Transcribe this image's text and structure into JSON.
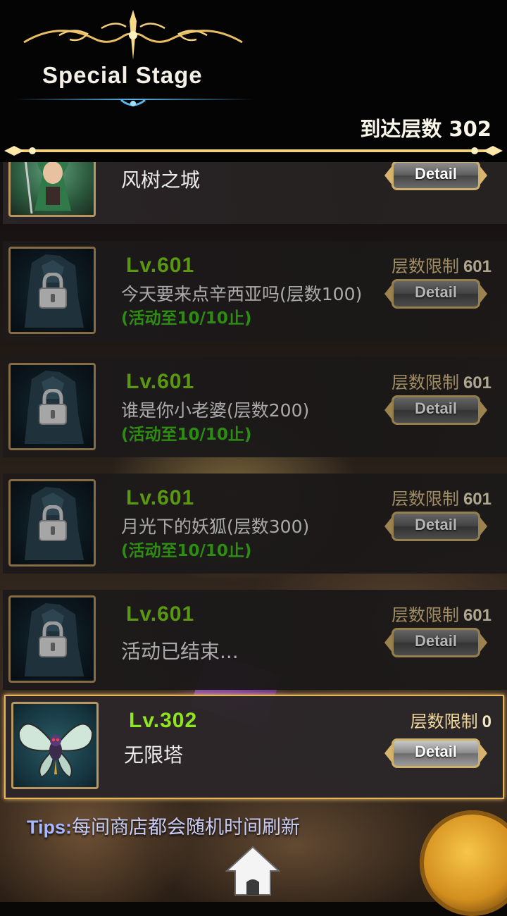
{
  "header": {
    "title": "Special Stage",
    "floor_reached_label": "到达层数",
    "floor_reached_value": "302"
  },
  "colors": {
    "level_green": "#7fd31a",
    "period_green": "#3fc21a",
    "gold_frame": "#cfb06a",
    "tips_blue": "#a8b8ff"
  },
  "stages": [
    {
      "level": "",
      "limit_label": "",
      "limit_value": "",
      "name": "风树之城",
      "period": "",
      "detail_label": "Detail",
      "locked": false,
      "portrait": "green-haired-warrior-portrait"
    },
    {
      "level": "Lv.601",
      "limit_label": "层数限制",
      "limit_value": "601",
      "name": "今天要来点辛西亚吗(层数100)",
      "period": "(活动至10/10止)",
      "detail_label": "Detail",
      "locked": true,
      "portrait": "locked-dark-knight-portrait"
    },
    {
      "level": "Lv.601",
      "limit_label": "层数限制",
      "limit_value": "601",
      "name": "谁是你小老婆(层数200)",
      "period": "(活动至10/10止)",
      "detail_label": "Detail",
      "locked": true,
      "portrait": "locked-dark-knight-portrait"
    },
    {
      "level": "Lv.601",
      "limit_label": "层数限制",
      "limit_value": "601",
      "name": "月光下的妖狐(层数300)",
      "period": "(活动至10/10止)",
      "detail_label": "Detail",
      "locked": true,
      "portrait": "locked-dark-knight-portrait"
    },
    {
      "level": "Lv.601",
      "limit_label": "层数限制",
      "limit_value": "601",
      "name": "活动已结束...",
      "period": "",
      "detail_label": "Detail",
      "locked": true,
      "portrait": "locked-dark-knight-portrait"
    },
    {
      "level": "Lv.302",
      "limit_label": "层数限制",
      "limit_value": "0",
      "name": "无限塔",
      "period": "",
      "detail_label": "Detail",
      "locked": false,
      "selected": true,
      "portrait": "butterfly-monster-portrait"
    }
  ],
  "tips": {
    "key": "Tips:",
    "text": "每间商店都会随机时间刷新"
  },
  "home": {
    "icon": "home-icon"
  }
}
